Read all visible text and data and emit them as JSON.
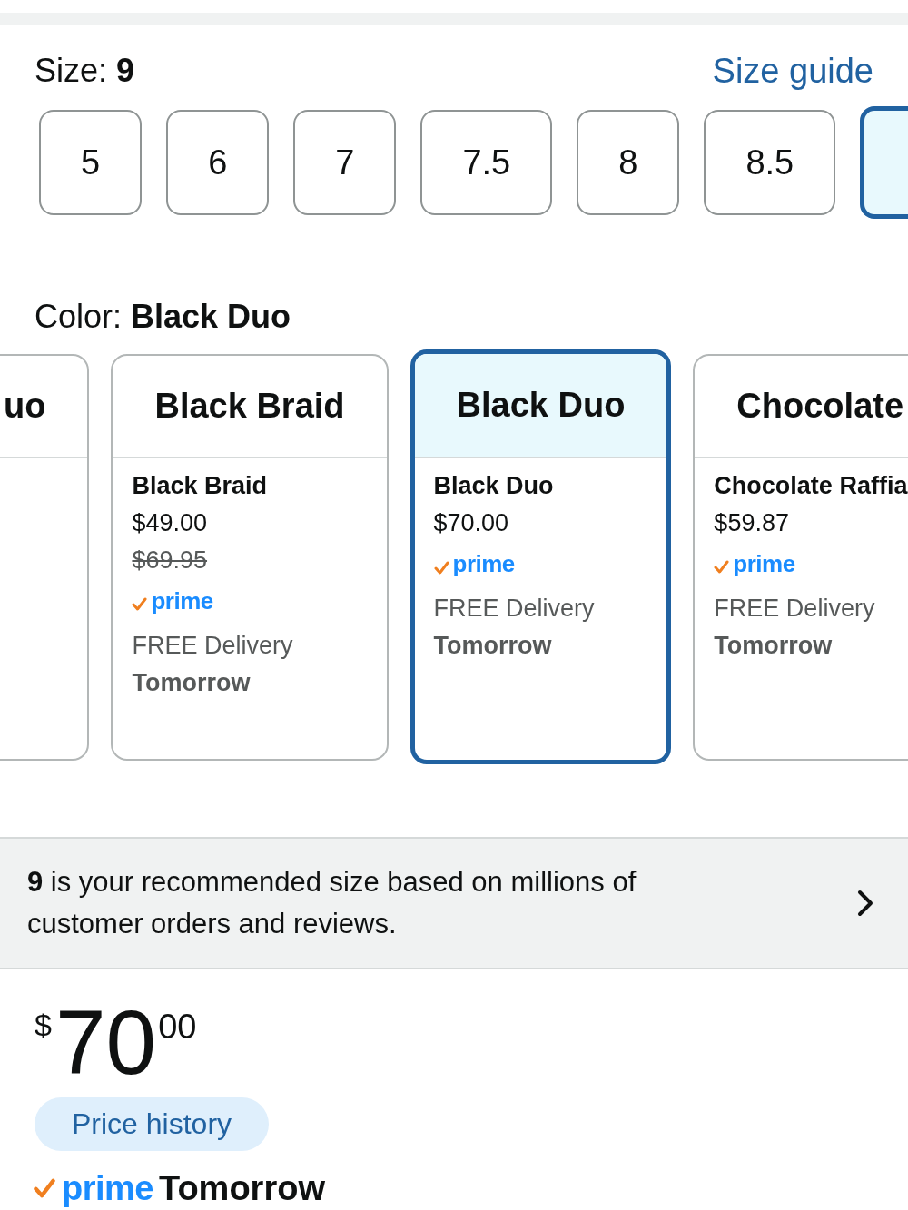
{
  "size": {
    "label": "Size: **9**",
    "guide_link": "Size guide"
  },
  "size_options": [
    {
      "label": "5",
      "selected": false
    },
    {
      "label": "6",
      "selected": false
    },
    {
      "label": "7",
      "selected": false
    },
    {
      "label": "7.5",
      "selected": false
    },
    {
      "label": "8",
      "selected": false
    },
    {
      "label": "8.5",
      "selected": false
    },
    {
      "selected": true
    }
  ],
  "color": {
    "label": "Color: **Black Duo**"
  },
  "color_options": [
    {
      "header": "uo",
      "selected": false
    },
    {
      "header": "Black Braid",
      "name": "Black Braid",
      "price": "$49.00",
      "list_price": "$69.95",
      "prime": "prime",
      "delivery": "FREE Delivery",
      "delivery_day": "Tomorrow",
      "selected": false
    },
    {
      "header": "Black Duo",
      "name": "Black Duo",
      "price": "$70.00",
      "prime": "prime",
      "delivery": "FREE Delivery",
      "delivery_day": "Tomorrow",
      "selected": true
    },
    {
      "header": "Chocolate",
      "name": "Chocolate Raffia",
      "price": "$59.87",
      "prime": "prime",
      "delivery": "FREE Delivery",
      "delivery_day": "Tomorrow",
      "selected": false
    }
  ],
  "recommendation": {
    "text": "**9** is your recommended size based on millions of customer orders and reviews."
  },
  "price": {
    "symbol": "$",
    "whole": "70",
    "fraction": "00"
  },
  "price_history_button": "Price history",
  "delivery": {
    "prime": "prime",
    "day": "Tomorrow"
  }
}
